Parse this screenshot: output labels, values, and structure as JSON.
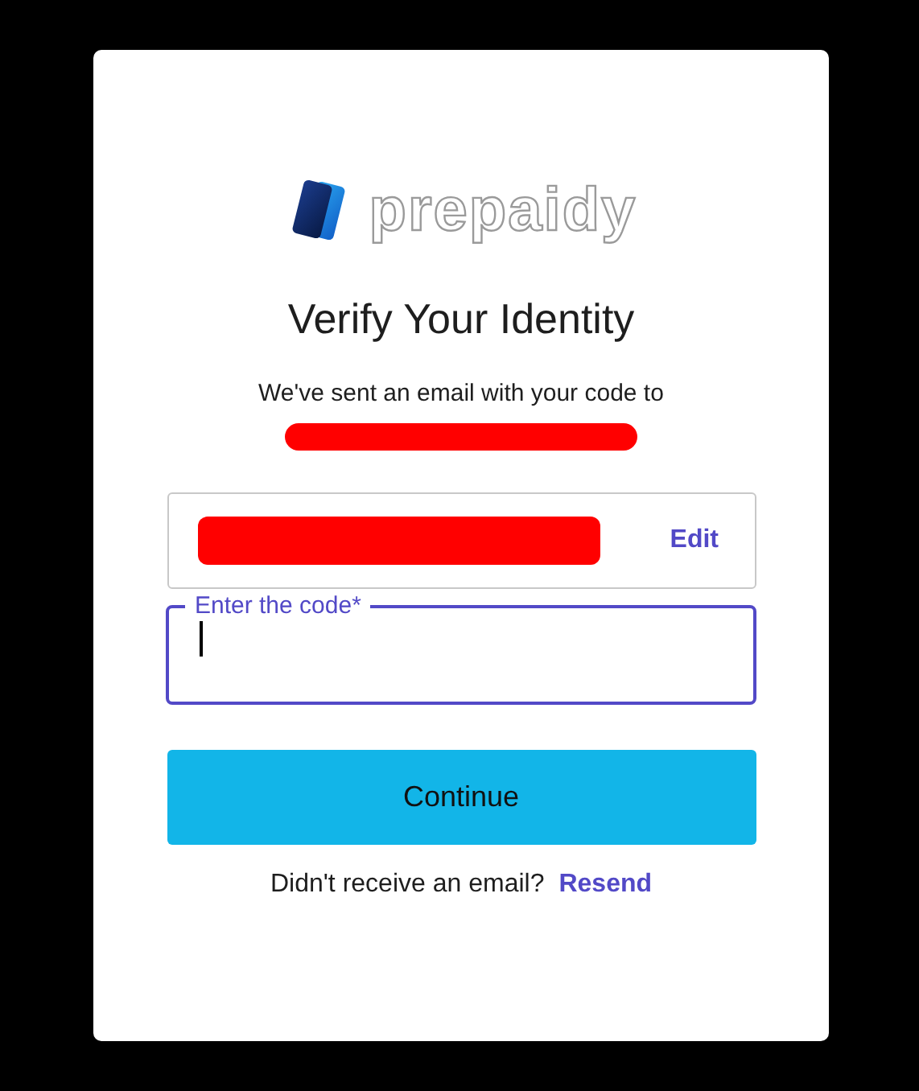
{
  "logo": {
    "text": "prepaidy"
  },
  "title": "Verify Your Identity",
  "message": "We've sent an email with your code to",
  "email_field": {
    "action": "Edit"
  },
  "code_field": {
    "label": "Enter the code*",
    "focused": true
  },
  "continue_button": "Continue",
  "resend": {
    "prompt": "Didn't receive an email?",
    "link": "Resend"
  }
}
